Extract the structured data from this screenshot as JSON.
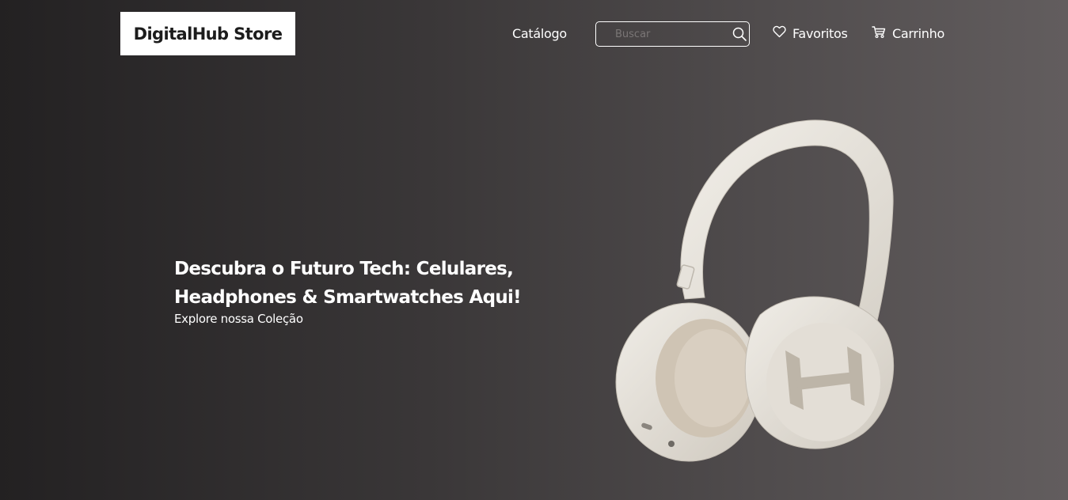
{
  "header": {
    "logo_text": "DigitalHub Store",
    "nav": {
      "catalog_label": "Catálogo",
      "favorites_label": "Favoritos",
      "cart_label": "Carrinho"
    },
    "search": {
      "placeholder": "Buscar",
      "value": ""
    },
    "icons": {
      "search": "search-icon",
      "favorites": "heart-icon",
      "cart": "cart-icon"
    }
  },
  "hero": {
    "title_line1": "Descubra o Futuro Tech: Celulares,",
    "title_line2": "Headphones & Smartwatches Aqui!",
    "subtitle": "Explore nossa Coleção",
    "product_image": "headphones-image"
  },
  "colors": {
    "background_start": "#232122",
    "background_end": "#625d5e",
    "logo_bg": "#ffffff",
    "text": "#ffffff"
  }
}
